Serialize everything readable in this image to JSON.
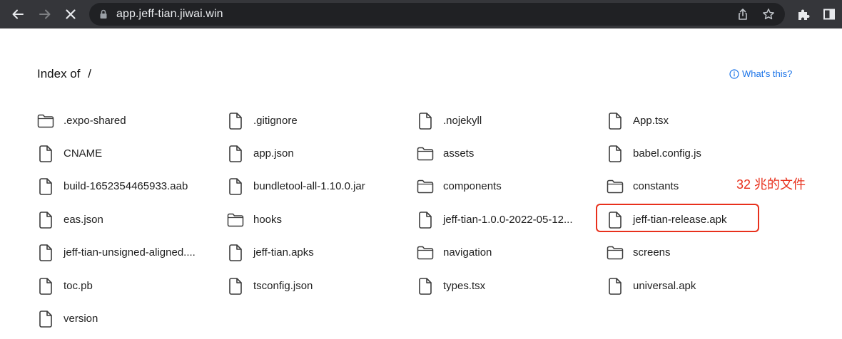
{
  "browser": {
    "url": "app.jeff-tian.jiwai.win",
    "icons": {
      "back": "back-arrow-icon",
      "forward": "forward-arrow-icon",
      "stop": "stop-loading-icon",
      "lock": "lock-icon",
      "share": "share-icon",
      "bookmark": "star-icon",
      "extensions": "puzzle-icon",
      "side_panel": "side-panel-icon"
    }
  },
  "page": {
    "title": "Index of",
    "path": "/",
    "help_link": "What's this?",
    "colors": {
      "link": "#1a73e8",
      "annotation": "#e8301c",
      "chrome": "#35363a"
    }
  },
  "columns": [
    [
      {
        "name": ".expo-shared",
        "type": "folder"
      },
      {
        "name": "CNAME",
        "type": "file"
      },
      {
        "name": "build-1652354465933.aab",
        "type": "file"
      },
      {
        "name": "eas.json",
        "type": "file"
      },
      {
        "name": "jeff-tian-unsigned-aligned....",
        "type": "file"
      },
      {
        "name": "toc.pb",
        "type": "file"
      },
      {
        "name": "version",
        "type": "file"
      }
    ],
    [
      {
        "name": ".gitignore",
        "type": "file"
      },
      {
        "name": "app.json",
        "type": "file"
      },
      {
        "name": "bundletool-all-1.10.0.jar",
        "type": "file"
      },
      {
        "name": "hooks",
        "type": "folder"
      },
      {
        "name": "jeff-tian.apks",
        "type": "file"
      },
      {
        "name": "tsconfig.json",
        "type": "file"
      }
    ],
    [
      {
        "name": ".nojekyll",
        "type": "file"
      },
      {
        "name": "assets",
        "type": "folder"
      },
      {
        "name": "components",
        "type": "folder"
      },
      {
        "name": "jeff-tian-1.0.0-2022-05-12...",
        "type": "file"
      },
      {
        "name": "navigation",
        "type": "folder"
      },
      {
        "name": "types.tsx",
        "type": "file"
      }
    ],
    [
      {
        "name": "App.tsx",
        "type": "file"
      },
      {
        "name": "babel.config.js",
        "type": "file"
      },
      {
        "name": "constants",
        "type": "folder"
      },
      {
        "name": "jeff-tian-release.apk",
        "type": "file"
      },
      {
        "name": "screens",
        "type": "folder"
      },
      {
        "name": "universal.apk",
        "type": "file"
      }
    ]
  ],
  "annotation": {
    "text": "32 兆的文件"
  }
}
